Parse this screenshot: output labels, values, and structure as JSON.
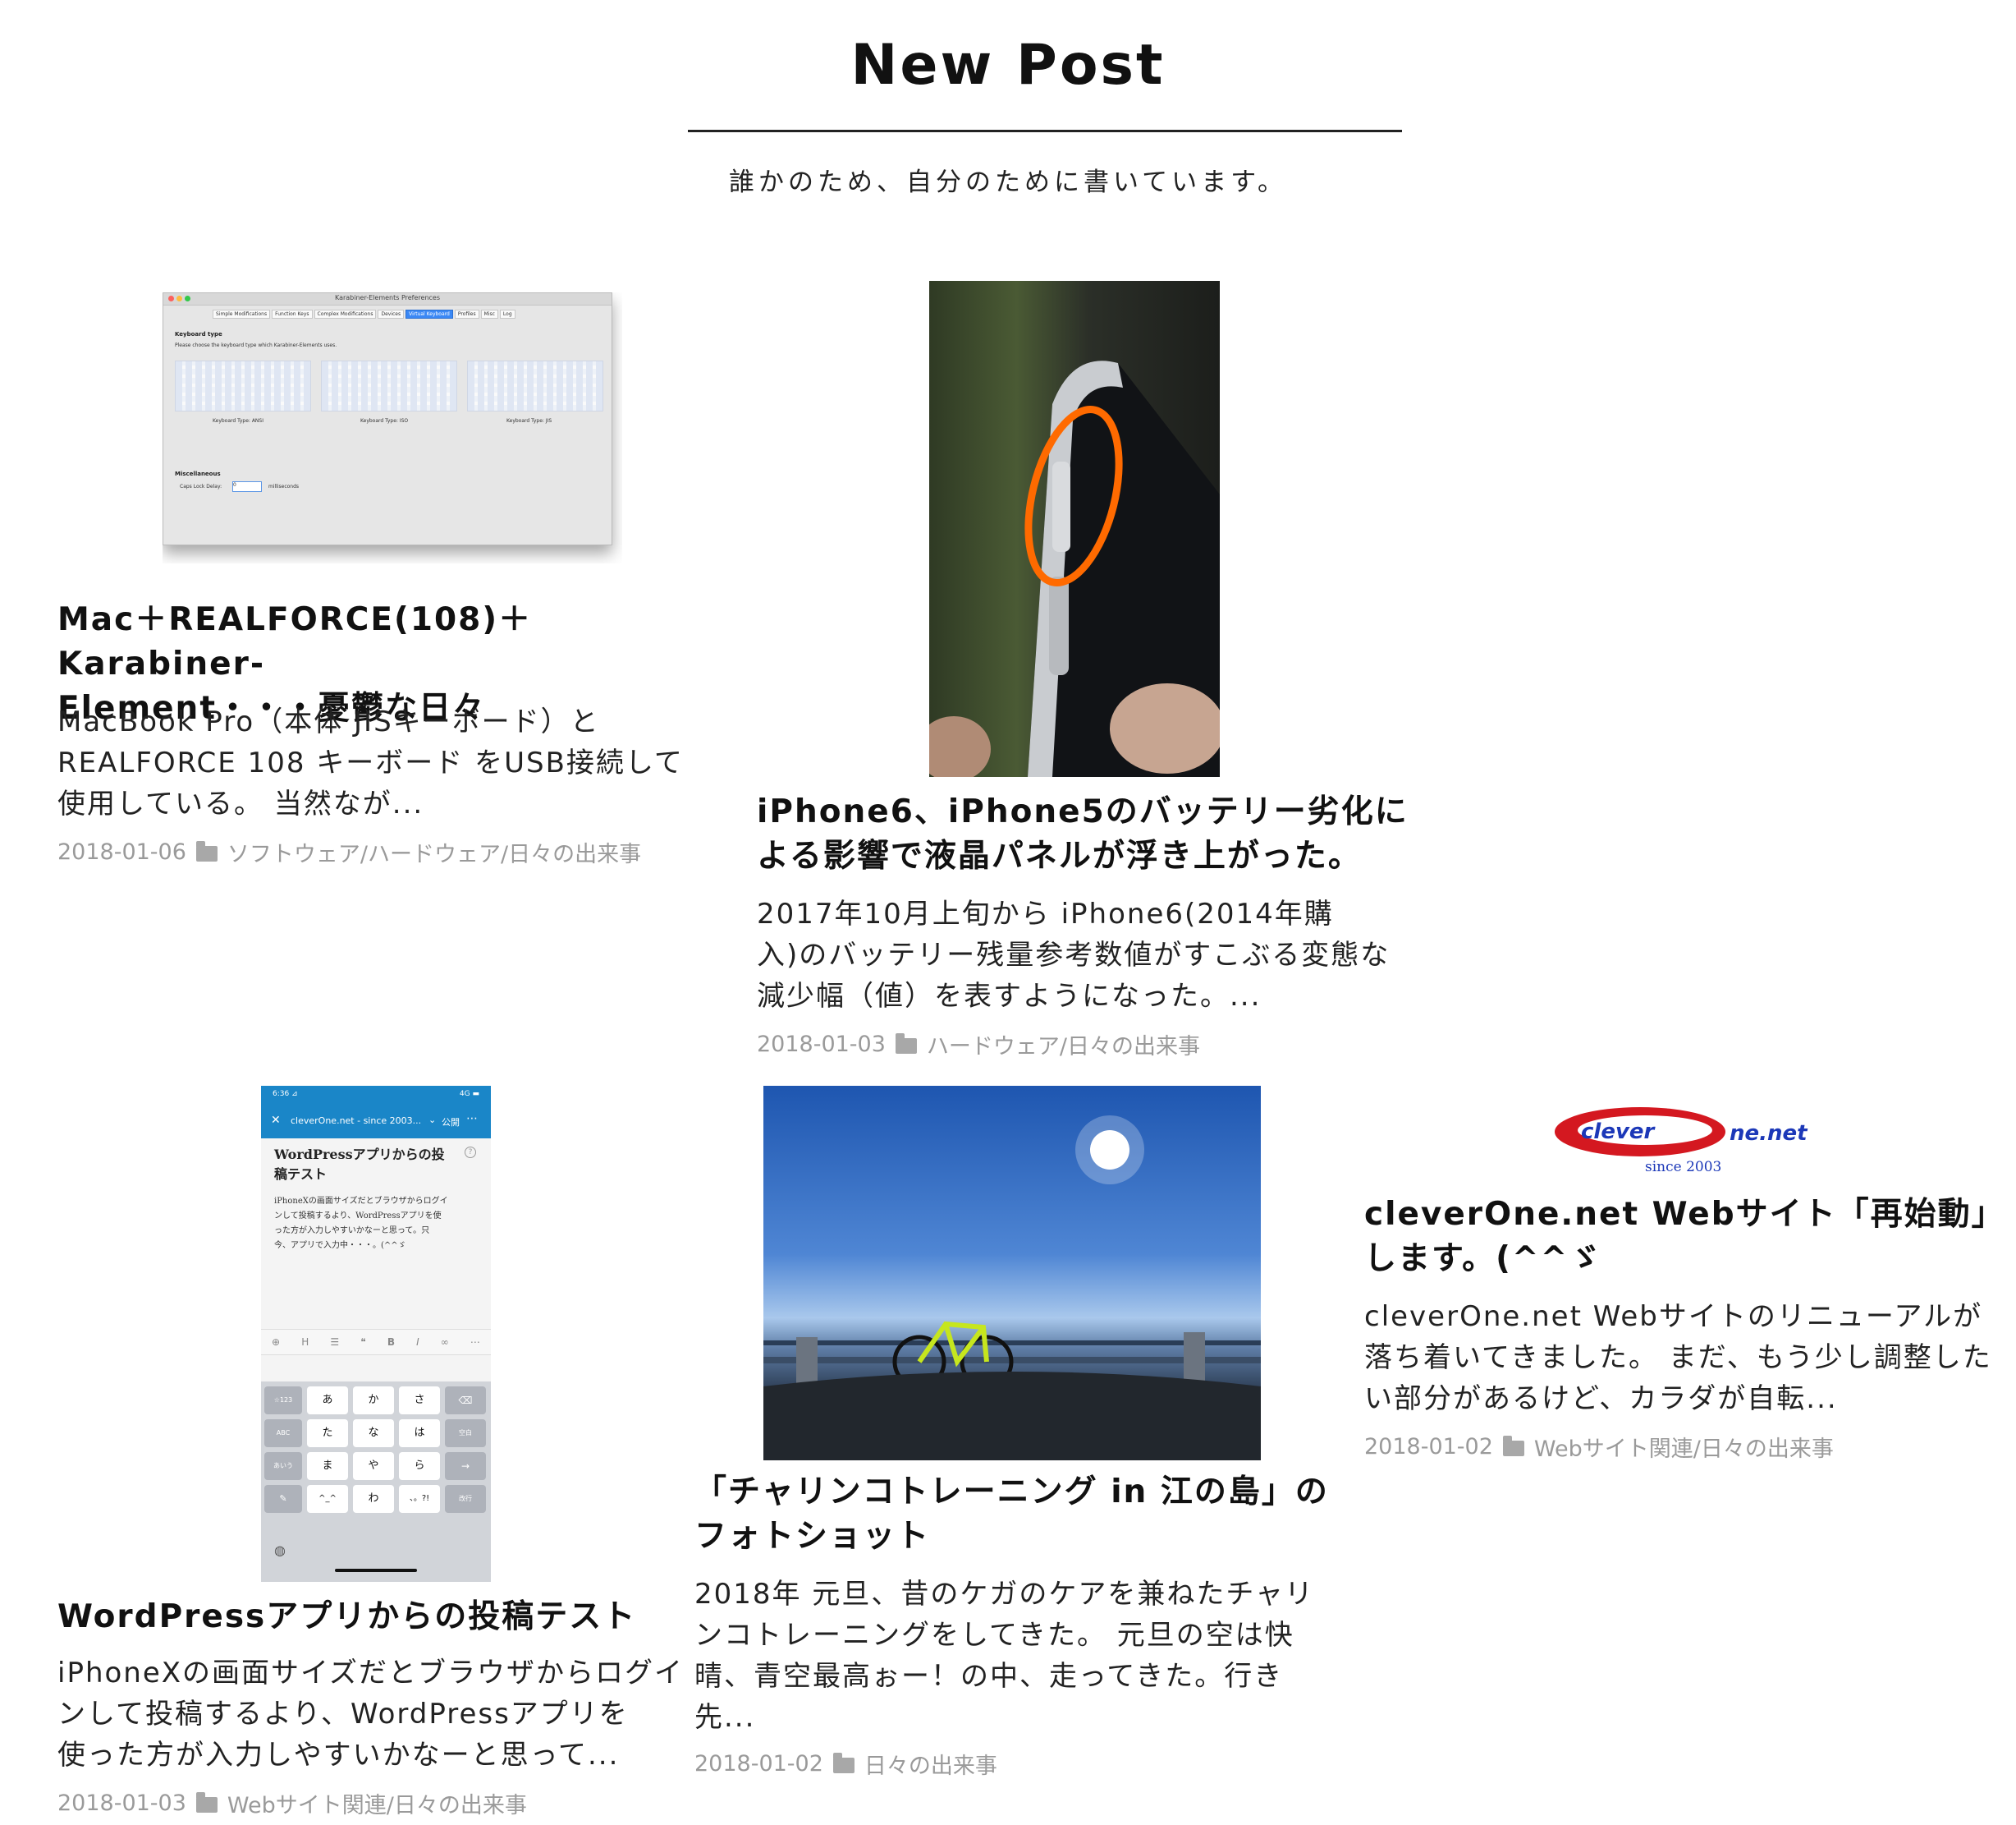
{
  "section": {
    "title": "New Post",
    "subtitle": "誰かのため、自分のために書いています。"
  },
  "posts": [
    {
      "title_line1": "Mac＋REALFORCE(108)＋Karabiner-",
      "title_line2": "Element・・・憂鬱な日々",
      "excerpt_line1": "MacBook Pro（本体 JISキーボード）と",
      "excerpt_line2": "REALFORCE 108 キーボード をUSB接続して",
      "excerpt_line3": "使用している。 当然なが...",
      "date": "2018-01-06",
      "category": "ソフトウェア/ハードウェア/日々の出来事",
      "thumb": {
        "window_title": "Karabiner-Elements Preferences",
        "tabs": [
          "Simple Modifications",
          "Function Keys",
          "Complex Modifications",
          "Devices",
          "Virtual Keyboard",
          "Profiles",
          "Misc",
          "Log"
        ],
        "section_label": "Keyboard type",
        "section_desc": "Please choose the keyboard type which Karabiner-Elements uses.",
        "options": [
          "Keyboard Type: ANSI",
          "Keyboard Type: ISO",
          "Keyboard Type: JIS"
        ],
        "misc_label": "Miscellaneous",
        "caps_label": "Caps Lock Delay:",
        "caps_value": "0",
        "caps_unit": "milliseconds"
      }
    },
    {
      "title_line1": "iPhone6、iPhone5のバッテリー劣化に",
      "title_line2": "よる影響で液晶パネルが浮き上がった。",
      "excerpt_line1": "2017年10月上旬から iPhone6(2014年購",
      "excerpt_line2": "入)のバッテリー残量参考数値がすこぶる変態な",
      "excerpt_line3": "減少幅（値）を表すようになった。...",
      "date": "2018-01-03",
      "category": "ハードウェア/日々の出来事"
    },
    {
      "title_line1": "WordPressアプリからの投稿テスト",
      "excerpt_line1": "iPhoneXの画面サイズだとブラウザからログイ",
      "excerpt_line2": "ンして投稿するより、WordPressアプリを",
      "excerpt_line3": "使った方が入力しやすいかなーと思って...",
      "date": "2018-01-03",
      "category": "Webサイト関連/日々の出来事",
      "thumb": {
        "status_time": "6:36 ⊿",
        "status_right": "4G ▬",
        "header": "cleverOne.net - since 2003...",
        "header_right": "公開",
        "post_title_line1": "WordPressアプリからの投",
        "post_title_line2": "稿テスト",
        "body_line1": "iPhoneXの画面サイズだとブラウザからログイ",
        "body_line2": "ンして投稿するより、WordPressアプリを使",
        "body_line3": "った方が入力しやすいかなーと思って。只",
        "body_line4": "今、アプリで入力中・・・。(^^ゞ",
        "keys": [
          "あ",
          "か",
          "さ",
          "た",
          "な",
          "は",
          "ま",
          "や",
          "ら",
          "^_^",
          "わ",
          "、。?!"
        ],
        "side_left": [
          "☆123",
          "ABC",
          "あいう"
        ],
        "side_right": [
          "⌫",
          "空白",
          "→",
          "改行"
        ]
      }
    },
    {
      "title_line1": "「チャリンコトレーニング in 江の島」の",
      "title_line2": "フォトショット",
      "excerpt_line1": "2018年 元旦、昔のケガのケアを兼ねたチャリ",
      "excerpt_line2": "ンコトレーニングをしてきた。 元旦の空は快",
      "excerpt_line3": "晴、青空最高ぉー！の中、走ってきた。行き",
      "excerpt_line4": "先...",
      "date": "2018-01-02",
      "category": "日々の出来事"
    },
    {
      "title_line1": "cleverOne.net Webサイト「再始動」",
      "title_line2": "します。(^^ゞ",
      "excerpt_line1": "cleverOne.net Webサイトのリニューアルが",
      "excerpt_line2": "落ち着いてきました。 まだ、もう少し調整した",
      "excerpt_line3": "い部分があるけど、カラダが自転...",
      "date": "2018-01-02",
      "category": "Webサイト関連/日々の出来事",
      "thumb": {
        "logo_left": "clever",
        "logo_right": "ne.net",
        "logo_since": "since 2003"
      }
    }
  ],
  "colors": {
    "text": "#111111",
    "meta": "#9a9a9a",
    "logo_red": "#d41820",
    "logo_blue": "#1c38b8",
    "phone_accent": "#ff6a00",
    "wp_blue": "#1a86c8"
  }
}
